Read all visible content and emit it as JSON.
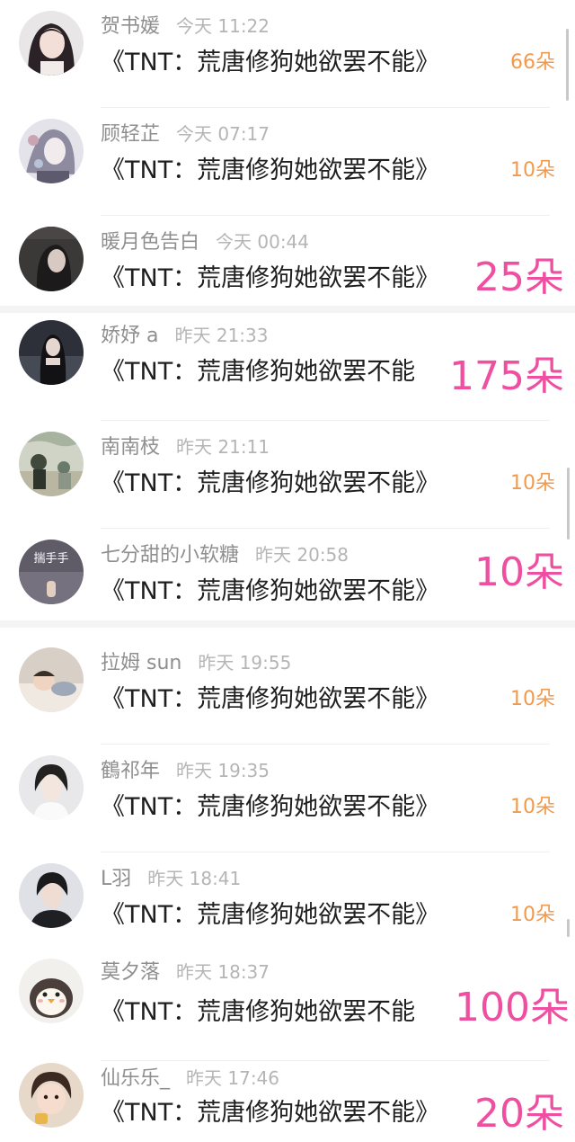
{
  "comments": [
    {
      "username": "贺书媛",
      "time": "今天 11:22",
      "message": "《TNT：荒唐修狗她欲罢不能》",
      "gift": "66朵",
      "gift_style": "small",
      "avatar_icon": "avatar-girl-portrait"
    },
    {
      "username": "顾轻芷",
      "time": "今天 07:17",
      "message": "《TNT：荒唐修狗她欲罢不能》",
      "gift": "10朵",
      "gift_style": "small",
      "avatar_icon": "avatar-anime-boy"
    },
    {
      "username": "暖月色告白",
      "time": "今天 00:44",
      "message": "《TNT：荒唐修狗她欲罢不能》",
      "gift": "25朵",
      "gift_style": "big",
      "avatar_icon": "avatar-girl-dark"
    },
    {
      "username": "娇妤 a",
      "time": "昨天 21:33",
      "message": "《TNT：荒唐修狗她欲罢不能",
      "gift": "175朵",
      "gift_style": "big",
      "avatar_icon": "avatar-girl-black-dress"
    },
    {
      "username": "南南枝",
      "time": "昨天 21:11",
      "message": "《TNT：荒唐修狗她欲罢不能》",
      "gift": "10朵",
      "gift_style": "small",
      "avatar_icon": "avatar-illustration"
    },
    {
      "username": "七分甜的小软糖",
      "time": "昨天 20:58",
      "message": "《TNT：荒唐修狗她欲罢不能》",
      "gift": "10朵",
      "gift_style": "big",
      "avatar_icon": "avatar-hand-text",
      "avatar_text": "揣手手"
    },
    {
      "username": "拉姆 sun",
      "time": "昨天 19:55",
      "message": "《TNT：荒唐修狗她欲罢不能》",
      "gift": "10朵",
      "gift_style": "small",
      "avatar_icon": "avatar-sleeping-child"
    },
    {
      "username": "鶴祁年",
      "time": "昨天 19:35",
      "message": "《TNT：荒唐修狗她欲罢不能》",
      "gift": "10朵",
      "gift_style": "small",
      "avatar_icon": "avatar-anime-boy-white"
    },
    {
      "username": "L羽",
      "time": "昨天 18:41",
      "message": "《TNT：荒唐修狗她欲罢不能》",
      "gift": "10朵",
      "gift_style": "small",
      "avatar_icon": "avatar-boy-portrait"
    },
    {
      "username": "莫夕落",
      "time": "昨天 18:37",
      "message": "《TNT：荒唐修狗她欲罢不能",
      "gift": "100朵",
      "gift_style": "big",
      "avatar_icon": "avatar-penguin"
    },
    {
      "username": "仙乐乐_",
      "time": "昨天 17:46",
      "message": "《TNT：荒唐修狗她欲罢不能》",
      "gift": "20朵",
      "gift_style": "big",
      "avatar_icon": "avatar-baby"
    }
  ],
  "colors": {
    "username": "#8f8f8f",
    "time": "#b5b5b5",
    "message": "#1f1f1f",
    "gift_small": "#f19a4c",
    "gift_big": "#ee4fa0"
  }
}
